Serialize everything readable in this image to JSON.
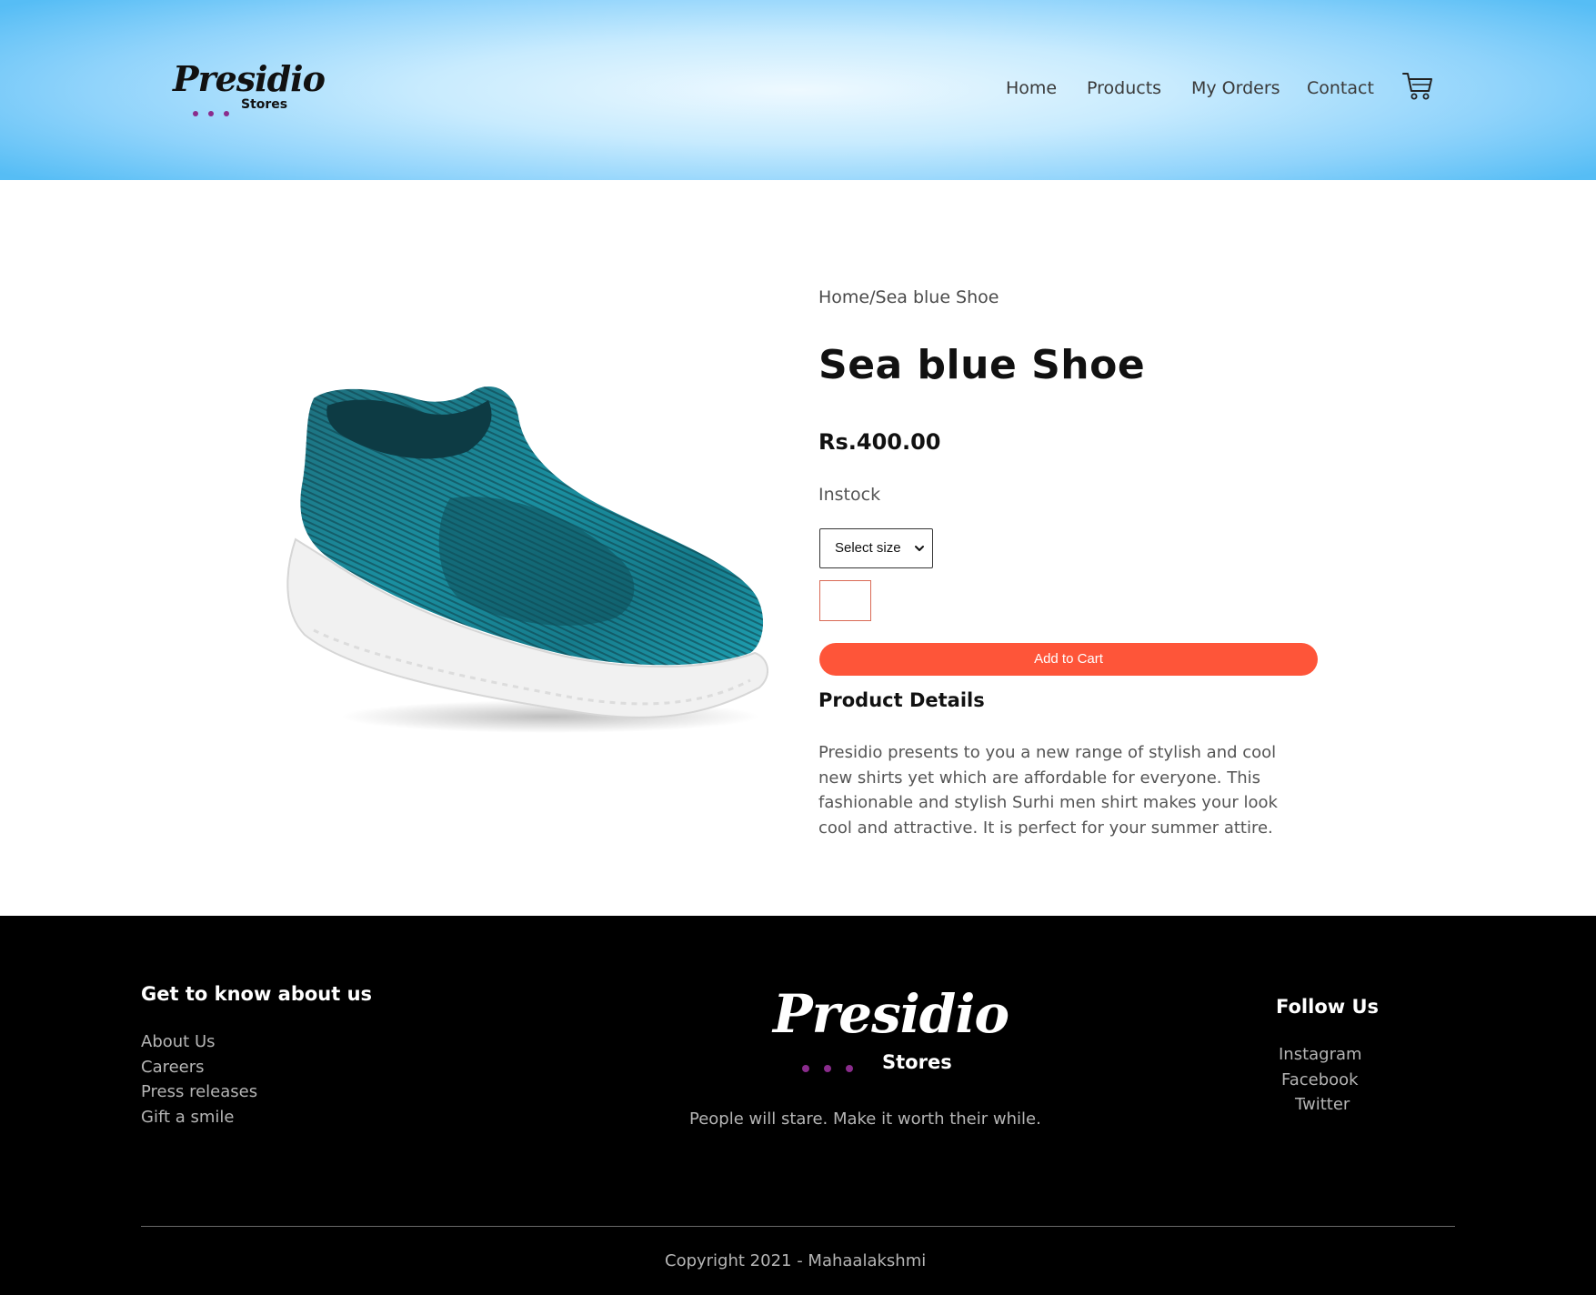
{
  "header": {
    "logo": {
      "script": "Presidio",
      "subtitle": "Stores"
    },
    "nav": [
      {
        "label": "Home"
      },
      {
        "label": "Products"
      },
      {
        "label": "My Orders"
      },
      {
        "label": "Contact"
      }
    ],
    "cart_icon": "cart-icon"
  },
  "product": {
    "breadcrumb": "Home/Sea blue Shoe",
    "title": "Sea blue Shoe",
    "price": "Rs.400.00",
    "stock": "Instock",
    "size_select": {
      "selected": "Select size"
    },
    "quantity_value": "",
    "add_to_cart_label": "Add to Cart",
    "details_heading": "Product Details",
    "description": "Presidio presents to you a new range of stylish and cool new shirts yet which are affordable for everyone. This fashionable and stylish Surhi men shirt makes your look cool and attractive. It is perfect for your summer attire.",
    "image_icon": "sea-blue-shoe-image"
  },
  "footer": {
    "about_heading": "Get to know about us",
    "about_links": [
      "About Us",
      "Careers",
      "Press releases",
      "Gift a smile"
    ],
    "logo": {
      "script": "Presidio",
      "subtitle": "Stores"
    },
    "tagline": "People will stare. Make it worth their while.",
    "follow_heading": "Follow Us",
    "follow_links": [
      "Instagram",
      "Facebook",
      "Twitter"
    ],
    "copyright": "Copyright 2021 - Mahaalakshmi"
  },
  "colors": {
    "accent_button": "#fe5539",
    "header_gradient_edge": "#56bdf5",
    "footer_bg": "#000000",
    "logo_dots": "#8a2c8c"
  }
}
